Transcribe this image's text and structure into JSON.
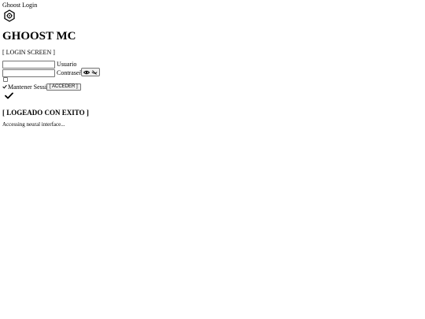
{
  "document": {
    "title": "Ghoost Login"
  },
  "brand": {
    "logo_icon": "gear-hexagon-icon",
    "name": "GHOOST MC"
  },
  "screen": {
    "label": "[ LOGIN SCREEN ]"
  },
  "form": {
    "username": {
      "value": "",
      "label": "Usuario"
    },
    "password": {
      "value": "",
      "label": "Contraseña",
      "toggle_icons": [
        "eye-icon",
        "eye-slash-icon"
      ]
    },
    "remember": {
      "checked": false,
      "check_icon": "check-icon",
      "label": "Mantener Session"
    },
    "submit_label": "[ ACCEDER ]"
  },
  "result": {
    "icon": "check-icon",
    "title": "[ LOGEADO CON EXITO ]",
    "status": "Accessing neural interface..."
  }
}
